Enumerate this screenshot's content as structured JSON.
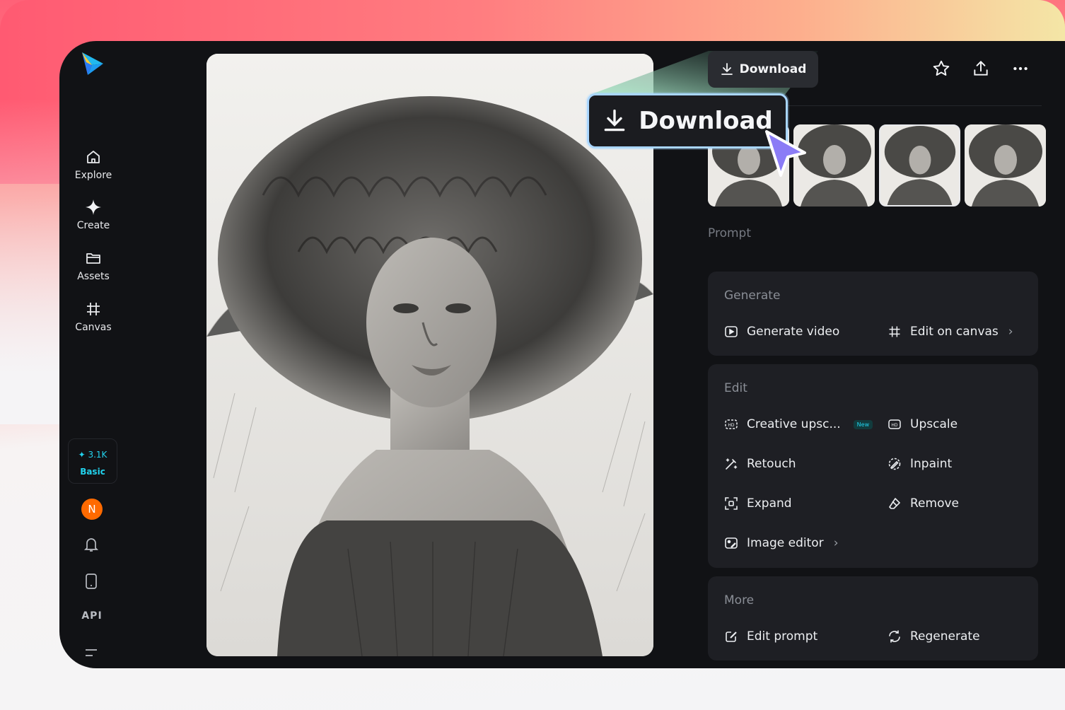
{
  "app": {
    "logo_icon": "paper-plane-logo-icon"
  },
  "sidebar": {
    "items": [
      {
        "label": "Explore",
        "icon": "home-icon"
      },
      {
        "label": "Create",
        "icon": "sparkle-icon"
      },
      {
        "label": "Assets",
        "icon": "folder-icon"
      },
      {
        "label": "Canvas",
        "icon": "crop-icon"
      }
    ],
    "credits": {
      "amount": "3.1K",
      "plan": "Basic"
    },
    "avatar_initial": "N",
    "api_label": "API"
  },
  "toolbar": {
    "download_label": "Download",
    "icons": [
      "star-icon",
      "share-icon",
      "more-icon"
    ]
  },
  "callout": {
    "download_label": "Download"
  },
  "thumbnails": {
    "count": 4,
    "selected_index": 2
  },
  "prompt": {
    "label": "Prompt"
  },
  "panels": {
    "generate": {
      "title": "Generate",
      "actions": [
        {
          "label": "Generate video",
          "icon": "play-icon"
        },
        {
          "label": "Edit on canvas",
          "icon": "crop-icon"
        }
      ]
    },
    "edit": {
      "title": "Edit",
      "new_badge": "New",
      "actions": [
        {
          "label": "Creative upsc...",
          "icon": "hd-icon"
        },
        {
          "label": "Upscale",
          "icon": "hd-icon"
        },
        {
          "label": "Retouch",
          "icon": "magic-wand-icon"
        },
        {
          "label": "Inpaint",
          "icon": "inpaint-icon"
        },
        {
          "label": "Expand",
          "icon": "expand-icon"
        },
        {
          "label": "Remove",
          "icon": "eraser-icon"
        },
        {
          "label": "Image editor",
          "icon": "image-edit-icon"
        }
      ]
    },
    "more": {
      "title": "More",
      "actions": [
        {
          "label": "Edit prompt",
          "icon": "edit-icon"
        },
        {
          "label": "Regenerate",
          "icon": "refresh-icon"
        }
      ]
    }
  },
  "colors": {
    "accent": "#22d3ee",
    "avatar": "#ff6a00",
    "highlight": "#a9d6ff",
    "cursor": "#8b7cf6"
  }
}
